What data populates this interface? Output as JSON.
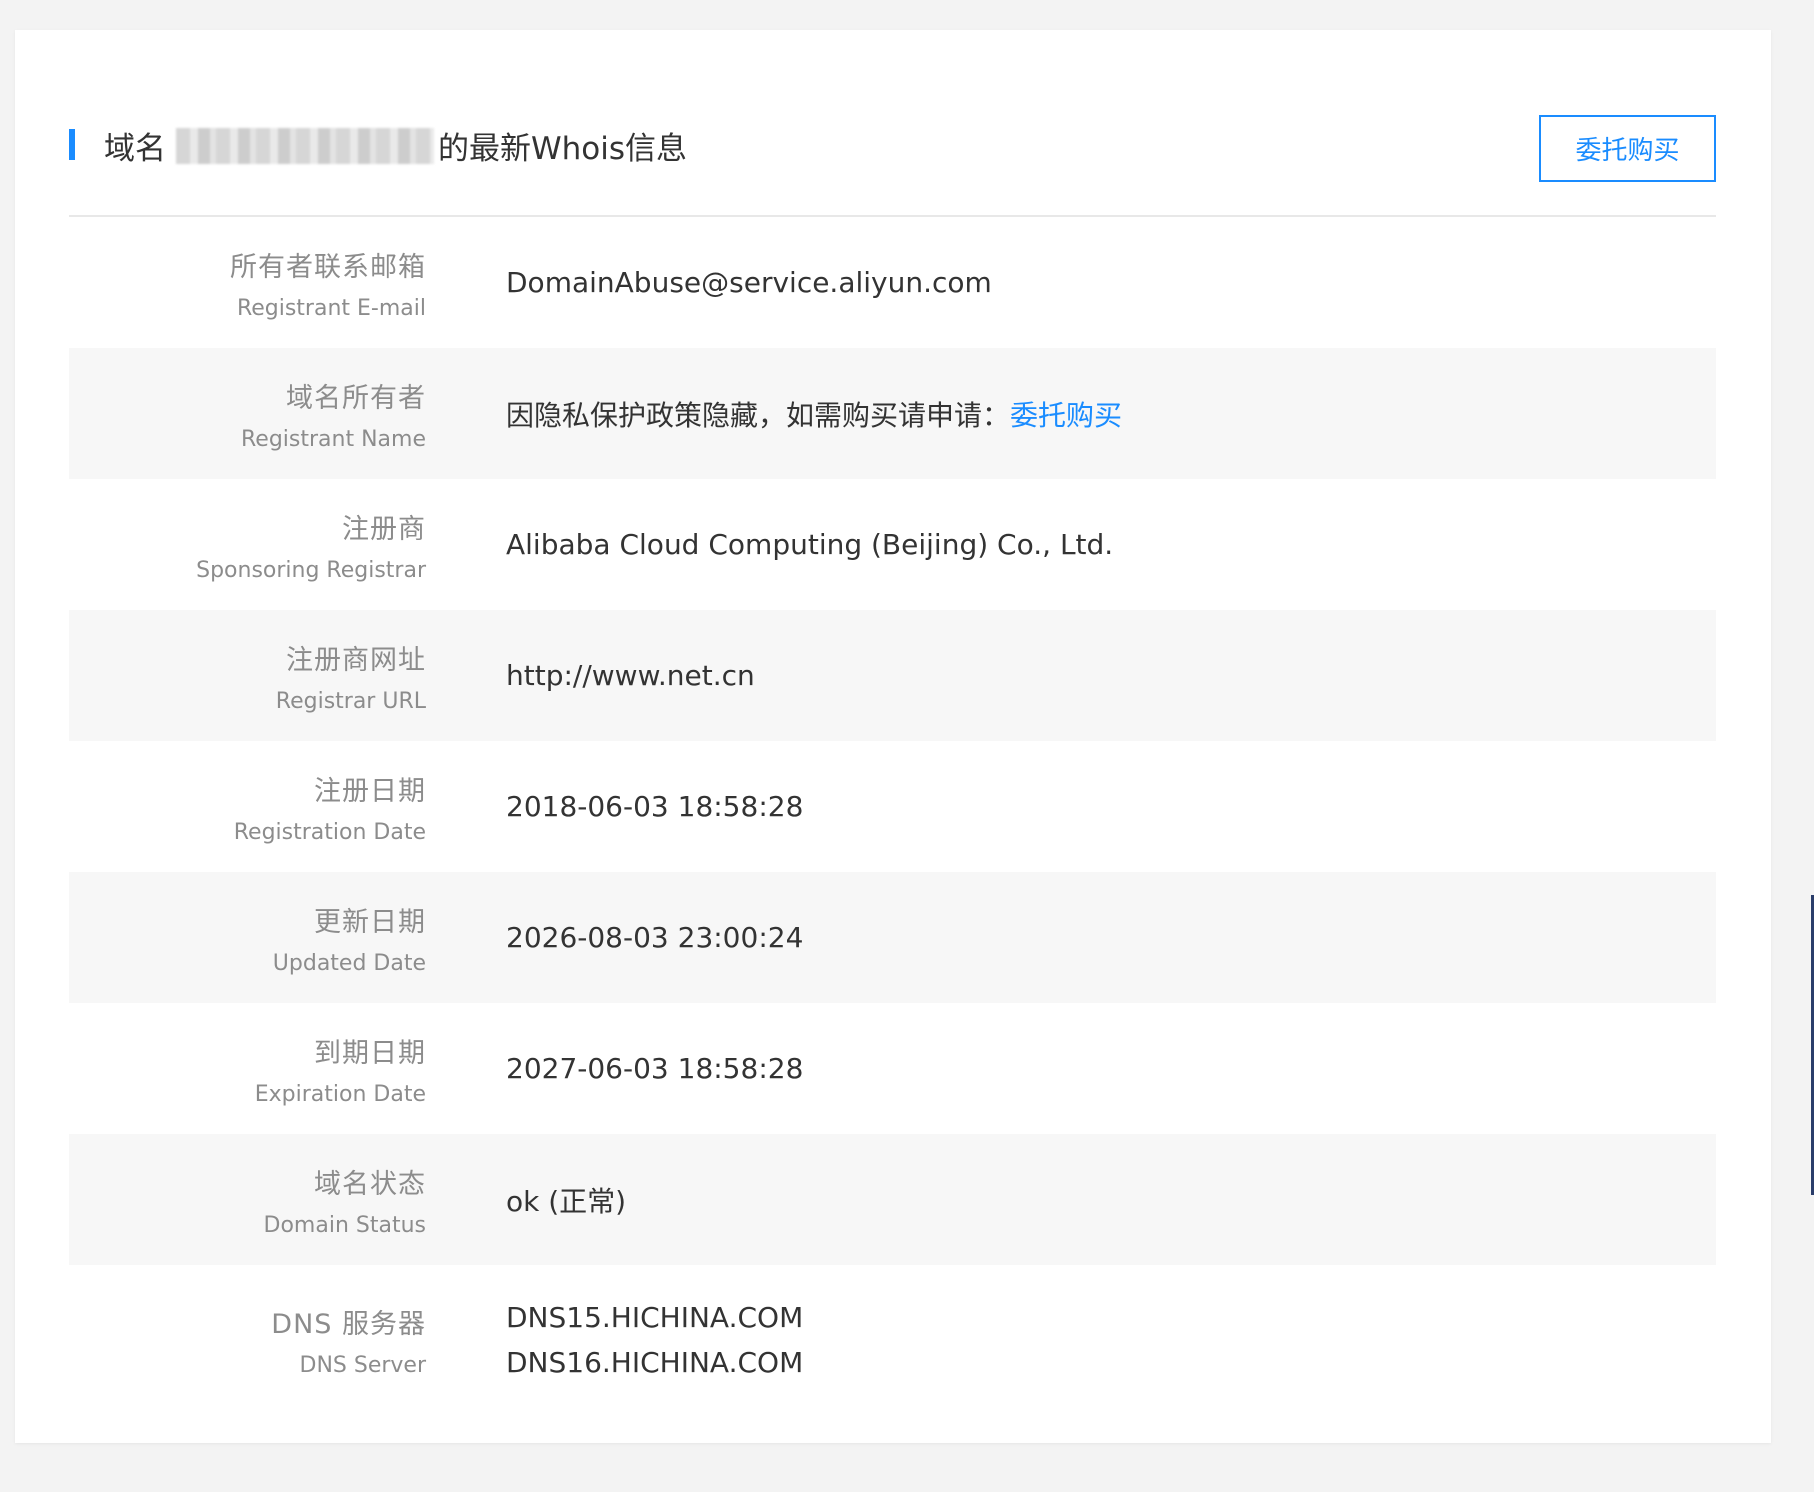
{
  "header": {
    "title_prefix": "域名",
    "title_suffix": "的最新Whois信息",
    "entrust_button": "委托购买"
  },
  "rows": [
    {
      "label_cn": "所有者联系邮箱",
      "label_en": "Registrant E-mail",
      "value": "DomainAbuse@service.aliyun.com"
    },
    {
      "label_cn": "域名所有者",
      "label_en": "Registrant Name",
      "value": "因隐私保护政策隐藏，如需购买请申请：",
      "link": "委托购买"
    },
    {
      "label_cn": "注册商",
      "label_en": "Sponsoring Registrar",
      "value": "Alibaba Cloud Computing (Beijing) Co., Ltd."
    },
    {
      "label_cn": "注册商网址",
      "label_en": "Registrar URL",
      "value": "http://www.net.cn"
    },
    {
      "label_cn": "注册日期",
      "label_en": "Registration Date",
      "value": "2018-06-03 18:58:28"
    },
    {
      "label_cn": "更新日期",
      "label_en": "Updated Date",
      "value": "2026-08-03 23:00:24"
    },
    {
      "label_cn": "到期日期",
      "label_en": "Expiration Date",
      "value": "2027-06-03 18:58:28"
    },
    {
      "label_cn": "域名状态",
      "label_en": "Domain Status",
      "value": "ok (正常)"
    },
    {
      "label_cn": "DNS 服务器",
      "label_en": "DNS Server",
      "values": [
        "DNS15.HICHINA.COM",
        "DNS16.HICHINA.COM"
      ]
    }
  ],
  "colors": {
    "accent": "#1a8cff",
    "label": "#8c8c8c",
    "text": "#333333",
    "row_alt_bg": "#f7f7f7",
    "page_bg": "#f3f3f3"
  }
}
